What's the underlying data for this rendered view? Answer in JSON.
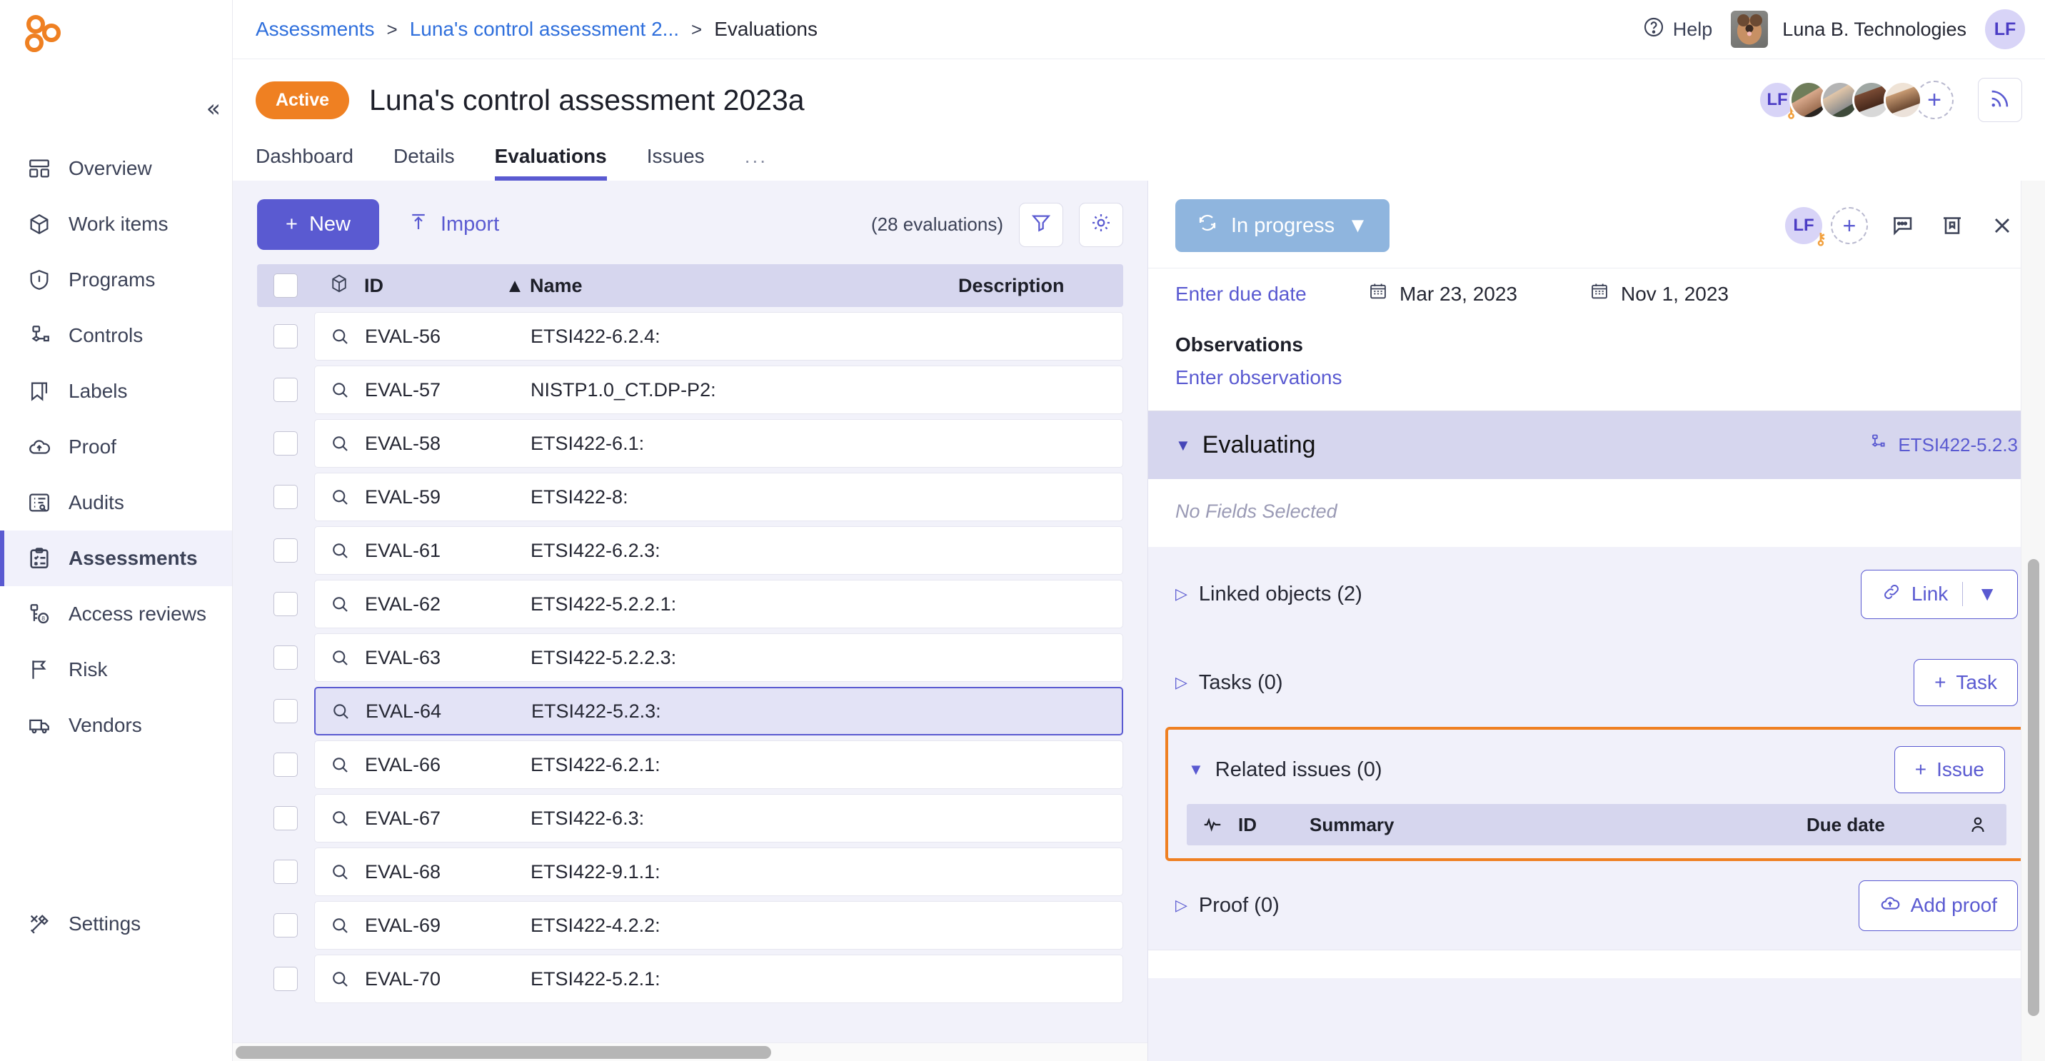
{
  "sidebar": {
    "logo_name": "app-logo",
    "collapse_label": "«",
    "items": [
      {
        "label": "Overview",
        "icon": "dashboard-icon"
      },
      {
        "label": "Work items",
        "icon": "box-icon"
      },
      {
        "label": "Programs",
        "icon": "shield-icon"
      },
      {
        "label": "Controls",
        "icon": "controls-icon"
      },
      {
        "label": "Labels",
        "icon": "bookmark-icon"
      },
      {
        "label": "Proof",
        "icon": "cloud-upload-icon"
      },
      {
        "label": "Audits",
        "icon": "audit-icon"
      },
      {
        "label": "Assessments",
        "icon": "clipboard-check-icon"
      },
      {
        "label": "Access reviews",
        "icon": "key-icon"
      },
      {
        "label": "Risk",
        "icon": "flag-icon"
      },
      {
        "label": "Vendors",
        "icon": "truck-icon"
      }
    ],
    "settings": {
      "label": "Settings",
      "icon": "tools-icon"
    }
  },
  "topbar": {
    "breadcrumb": [
      {
        "label": "Assessments",
        "type": "link"
      },
      {
        "label": ">",
        "type": "sep"
      },
      {
        "label": "Luna's control assessment 2...",
        "type": "link"
      },
      {
        "label": ">",
        "type": "sep"
      },
      {
        "label": "Evaluations",
        "type": "current"
      }
    ],
    "help_label": "Help",
    "org_name": "Luna B. Technologies",
    "user_initials": "LF"
  },
  "page": {
    "status_badge": "Active",
    "title": "Luna's control assessment 2023a",
    "tabs": [
      {
        "label": "Dashboard",
        "active": false
      },
      {
        "label": "Details",
        "active": false
      },
      {
        "label": "Evaluations",
        "active": true
      },
      {
        "label": "Issues",
        "active": false
      },
      {
        "label": "...",
        "active": false
      }
    ],
    "avatar_initials": "LF",
    "add_member_label": "+",
    "rss_label": "rss-icon"
  },
  "list": {
    "new_label": "New",
    "import_label": "Import",
    "count_label": "(28 evaluations)",
    "filter_icon": "filter-icon",
    "settings_icon": "gear-icon",
    "columns": {
      "id": "ID",
      "name": "Name",
      "description": "Description"
    },
    "rows": [
      {
        "id": "EVAL-56",
        "name": "ETSI422-6.2.4:",
        "description": "",
        "selected": false
      },
      {
        "id": "EVAL-57",
        "name": "NISTP1.0_CT.DP-P2:",
        "description": "",
        "selected": false
      },
      {
        "id": "EVAL-58",
        "name": "ETSI422-6.1:",
        "description": "",
        "selected": false
      },
      {
        "id": "EVAL-59",
        "name": "ETSI422-8:",
        "description": "",
        "selected": false
      },
      {
        "id": "EVAL-61",
        "name": "ETSI422-6.2.3:",
        "description": "",
        "selected": false
      },
      {
        "id": "EVAL-62",
        "name": "ETSI422-5.2.2.1:",
        "description": "",
        "selected": false
      },
      {
        "id": "EVAL-63",
        "name": "ETSI422-5.2.2.3:",
        "description": "",
        "selected": false
      },
      {
        "id": "EVAL-64",
        "name": "ETSI422-5.2.3:",
        "description": "",
        "selected": true
      },
      {
        "id": "EVAL-66",
        "name": "ETSI422-6.2.1:",
        "description": "",
        "selected": false
      },
      {
        "id": "EVAL-67",
        "name": "ETSI422-6.3:",
        "description": "",
        "selected": false
      },
      {
        "id": "EVAL-68",
        "name": "ETSI422-9.1.1:",
        "description": "",
        "selected": false
      },
      {
        "id": "EVAL-69",
        "name": "ETSI422-4.2.2:",
        "description": "",
        "selected": false
      },
      {
        "id": "EVAL-70",
        "name": "ETSI422-5.2.1:",
        "description": "",
        "selected": false
      }
    ]
  },
  "detail": {
    "status_label": "In progress",
    "status_caret": "▼",
    "assignee_initials": "LF",
    "add_assignee_label": "+",
    "due_date_placeholder": "Enter due date",
    "date_start": "Mar 23, 2023",
    "date_end": "Nov 1, 2023",
    "observations_title": "Observations",
    "observations_placeholder": "Enter observations",
    "evaluating": {
      "caret": "▼",
      "title": "Evaluating",
      "reference": "ETSI422-5.2.3",
      "empty_text": "No Fields Selected"
    },
    "sections": [
      {
        "label": "Linked objects (2)",
        "caret": "▷",
        "button": "Link",
        "has_split": true
      },
      {
        "label": "Tasks (0)",
        "caret": "▷",
        "button": "Task",
        "has_split": false
      },
      {
        "label": "Proof (0)",
        "caret": "▷",
        "button": "Add proof",
        "has_split": false
      }
    ],
    "related_issues": {
      "caret": "▼",
      "label": "Related issues (0)",
      "button": "Issue",
      "columns": {
        "status_icon": "activity-icon",
        "id": "ID",
        "summary": "Summary",
        "due_date": "Due date",
        "assignee_icon": "user-icon"
      },
      "highlight_color": "#ef8022"
    }
  },
  "colors": {
    "brand_orange": "#ef8022",
    "brand_purple": "#5a5ad1",
    "link_blue": "#2f6fdc",
    "status_blue": "#8fb5de"
  }
}
